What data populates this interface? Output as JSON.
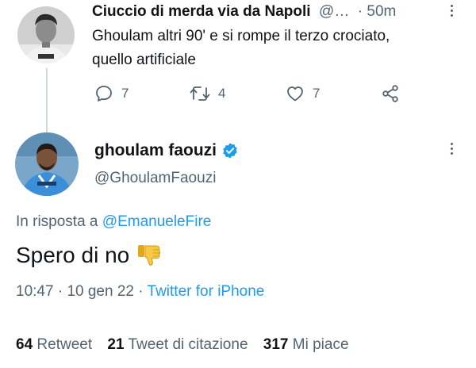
{
  "reply_tweet": {
    "display_name": "Ciuccio di merda via da Napoli",
    "handle_truncated": "@…",
    "time": "· 50m",
    "text_line1": "Ghoulam altri 90' e si rompe il terzo crociato,",
    "text_line2": "quello artificiale",
    "actions": {
      "reply_count": "7",
      "retweet_count": "4",
      "like_count": "7"
    }
  },
  "main_tweet": {
    "display_name": "ghoulam faouzi",
    "verified": true,
    "handle": "@GhoulamFaouzi",
    "reply_to_prefix": "In risposta a",
    "reply_to_handle": "@EmanueleFire",
    "text": "Spero di no",
    "emoji": "thumbs-down",
    "time": "10:47",
    "date": "10 gen 22",
    "source": "Twitter for iPhone"
  },
  "stats": {
    "retweets_count": "64",
    "retweets_label": "Retweet",
    "quotes_count": "21",
    "quotes_label": "Tweet di citazione",
    "likes_count": "317",
    "likes_label": "Mi piace"
  },
  "colors": {
    "accent": "#1d9bf0",
    "text": "#0f1419",
    "muted": "#536471",
    "thread_line": "#cfd9de",
    "emoji": "#f7c948"
  }
}
